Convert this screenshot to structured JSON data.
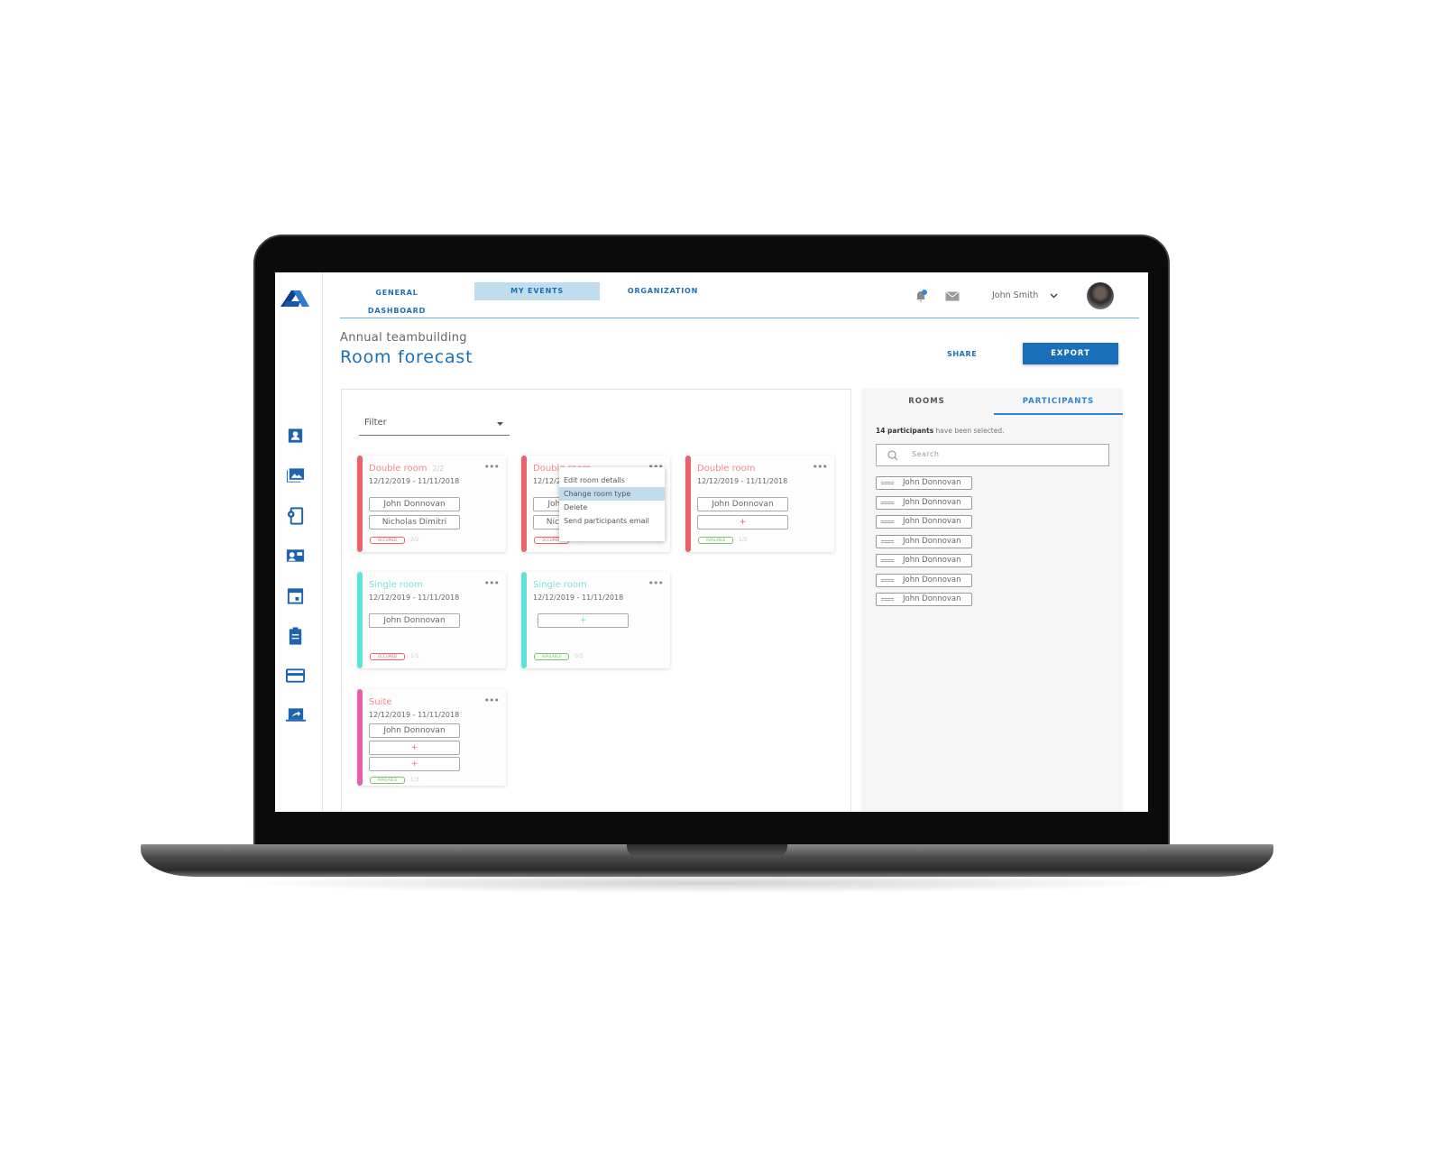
{
  "nav": {
    "tabs": [
      {
        "label": "GENERAL DASHBOARD"
      },
      {
        "label": "MY EVENTS",
        "active": true
      },
      {
        "label": "ORGANIZATION"
      }
    ],
    "user_name": "John Smith"
  },
  "sidebar": {
    "icons": [
      "contact-card-icon",
      "image-gallery-icon",
      "device-settings-icon",
      "id-card-icon",
      "calendar-icon",
      "clipboard-icon",
      "credit-card-icon",
      "share-screen-icon"
    ]
  },
  "page": {
    "subtitle": "Annual teambuilding",
    "title": "Room forecast",
    "share_label": "SHARE",
    "export_label": "EXPORT"
  },
  "filter": {
    "label": "Filter"
  },
  "colors": {
    "primary": "#1a6fb8",
    "double": "#e8646a",
    "single": "#5ce3da",
    "suite": "#e65fad",
    "occupied": "#e8646a",
    "available": "#7cc46a",
    "active_tab_bg": "#c1dced"
  },
  "cards": [
    {
      "type": "Double room",
      "count": "2/2",
      "dates": "12/12/2019 -  11/11/2018",
      "color": "#e8646a",
      "slots": [
        "John Donnovan",
        "Nicholas Dimitri"
      ],
      "status": "OCCUPIED",
      "fraction": "2/2"
    },
    {
      "type": "Double room",
      "count": "",
      "dates": "12/12/2019 -  11/11/2018",
      "color": "#e8646a",
      "slots": [
        "John Donnovan",
        "Nicholas Dimitri"
      ],
      "status": "OCCUPIED",
      "fraction": "2/2"
    },
    {
      "type": "Double room",
      "count": "",
      "dates": "12/12/2019 -  11/11/2018",
      "color": "#e8646a",
      "slots": [
        "John Donnovan",
        "+"
      ],
      "status": "AVAILABLE",
      "fraction": "1/2"
    },
    {
      "type": "Single room",
      "count": "",
      "dates": "12/12/2019 -  11/11/2018",
      "color": "#5ce3da",
      "slots": [
        "John Donnovan"
      ],
      "status": "OCCUPIED",
      "fraction": "1/1"
    },
    {
      "type": "Single room",
      "count": "",
      "dates": "12/12/2019 -  11/11/2018",
      "color": "#5ce3da",
      "slots": [
        "+"
      ],
      "status": "AVAILABLE",
      "fraction": "0/1"
    },
    {
      "type": "Suite",
      "count": "",
      "dates": "12/12/2019 -  11/11/2018",
      "color": "#e65fad",
      "slots": [
        "John Donnovan",
        "+",
        "+"
      ],
      "status": "AVAILABLE",
      "fraction": "1/3"
    }
  ],
  "context_menu": {
    "items": [
      "Edit room details",
      "Change room type",
      "Delete",
      "Send participants email"
    ],
    "highlighted": 1
  },
  "panel": {
    "tabs": [
      "ROOMS",
      "PARTICIPANTS"
    ],
    "active_tab": "PARTICIPANTS",
    "count_bold": "14 participants",
    "count_rest": " have been selected.",
    "search_placeholder": "Search",
    "participants": [
      "John Donnovan",
      "John Donnovan",
      "John Donnovan",
      "John Donnovan",
      "John Donnovan",
      "John Donnovan",
      "John Donnovan"
    ]
  }
}
